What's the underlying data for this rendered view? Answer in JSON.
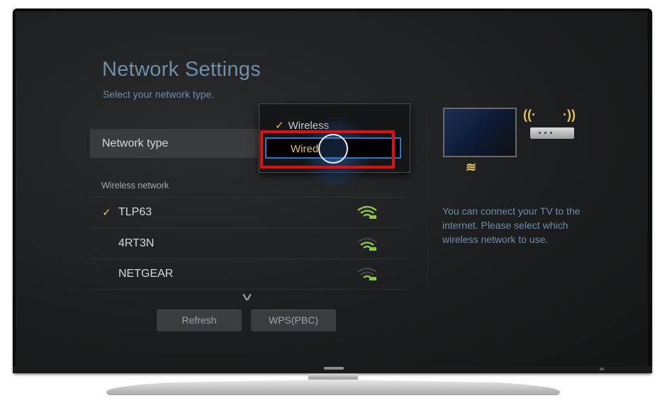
{
  "screen": {
    "title": "Network Settings",
    "subtitle": "Select your network type.",
    "network_type_label": "Network type",
    "section_label": "Wireless network",
    "networks": [
      {
        "name": "TLP63",
        "checked": true,
        "signal": "strong"
      },
      {
        "name": "4RT3N",
        "checked": false,
        "signal": "weak"
      },
      {
        "name": "NETGEAR",
        "checked": false,
        "signal": "weak"
      }
    ],
    "more_indicator": "chevron-down",
    "buttons": {
      "refresh": "Refresh",
      "wps": "WPS(PBC)"
    },
    "dropdown": {
      "options": [
        {
          "label": "Wireless",
          "checked": true
        },
        {
          "label": "Wired",
          "checked": false,
          "focused": true
        }
      ]
    },
    "help_text": "You can connect your TV to the internet. Please select which wireless network to use."
  },
  "colors": {
    "accent": "#e5c15a",
    "title": "#6f8fa6",
    "focus_border": "#2a78c8",
    "annotation": "#e01010"
  }
}
